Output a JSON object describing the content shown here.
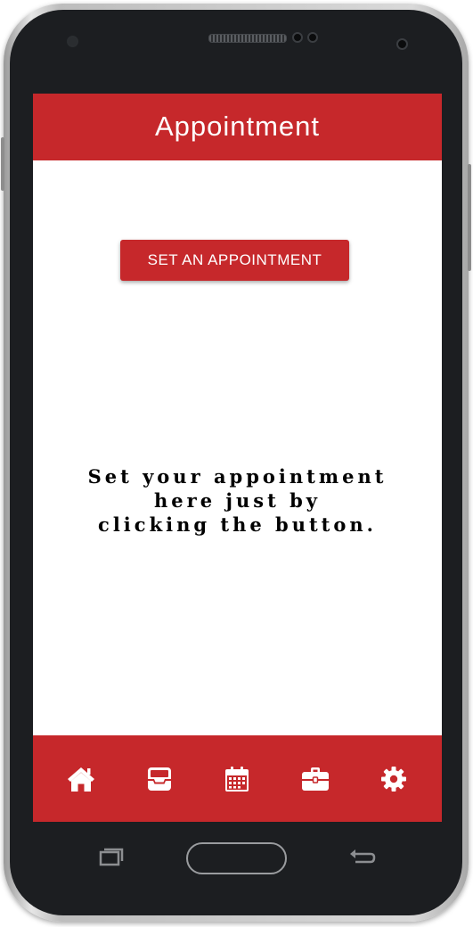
{
  "app_bar": {
    "title": "Appointment"
  },
  "main": {
    "button_label": "SET AN APPOINTMENT",
    "message_lines": [
      "Set your appointment",
      "here just by",
      "clicking the button."
    ]
  },
  "bottom_nav": {
    "items": [
      {
        "icon": "home-icon"
      },
      {
        "icon": "inbox-tray-icon"
      },
      {
        "icon": "calendar-icon"
      },
      {
        "icon": "briefcase-icon"
      },
      {
        "icon": "gear-icon"
      }
    ]
  },
  "colors": {
    "accent": "#c6282b",
    "background": "#ffffff",
    "text": "#000000",
    "icon": "#ffffff"
  }
}
